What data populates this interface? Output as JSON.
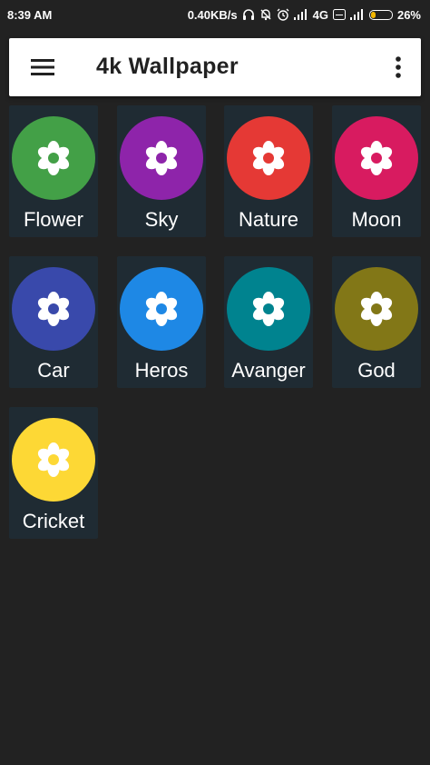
{
  "status_bar": {
    "time": "8:39 AM",
    "speed": "0.40KB/s",
    "network": "4G",
    "battery": "26%",
    "battery_level": 0.26
  },
  "app_bar": {
    "title": "4k Wallpaper",
    "menu_icon": "hamburger-menu-icon",
    "overflow_icon": "more-vert-icon"
  },
  "categories": [
    {
      "label": "Flower",
      "color": "#43a047",
      "icon": "flower-icon"
    },
    {
      "label": "Sky",
      "color": "#8e24aa",
      "icon": "flower-icon"
    },
    {
      "label": "Nature",
      "color": "#e53935",
      "icon": "flower-icon"
    },
    {
      "label": "Moon",
      "color": "#d81b60",
      "icon": "flower-icon"
    },
    {
      "label": "Car",
      "color": "#3949ab",
      "icon": "flower-icon"
    },
    {
      "label": "Heros",
      "color": "#1e88e5",
      "icon": "flower-icon"
    },
    {
      "label": "Avanger",
      "color": "#00838f",
      "icon": "flower-icon"
    },
    {
      "label": "God",
      "color": "#827717",
      "icon": "flower-icon"
    },
    {
      "label": "Cricket",
      "color": "#fdd835",
      "icon": "flower-icon"
    }
  ]
}
